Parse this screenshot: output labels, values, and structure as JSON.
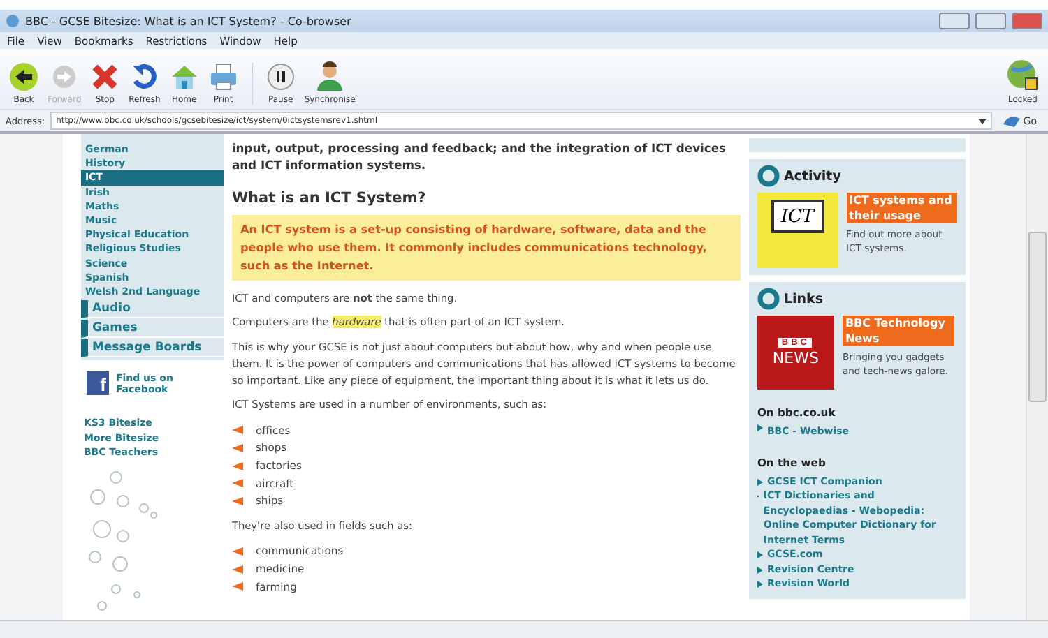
{
  "window": {
    "title": "BBC - GCSE Bitesize: What is an ICT System? - Co-browser"
  },
  "menu": [
    "File",
    "View",
    "Bookmarks",
    "Restrictions",
    "Window",
    "Help"
  ],
  "toolbar": [
    {
      "kind": "back",
      "label": "Back",
      "disabled": false
    },
    {
      "kind": "forward",
      "label": "Forward",
      "disabled": true
    },
    {
      "kind": "stop",
      "label": "Stop",
      "disabled": false
    },
    {
      "kind": "refresh",
      "label": "Refresh",
      "disabled": false
    },
    {
      "kind": "home",
      "label": "Home",
      "disabled": false
    },
    {
      "kind": "print",
      "label": "Print",
      "disabled": false
    },
    {
      "kind": "pause",
      "label": "Pause",
      "disabled": false
    },
    {
      "kind": "sync",
      "label": "Synchronise",
      "disabled": false
    }
  ],
  "lock": {
    "label": "Locked"
  },
  "address": {
    "label": "Address:",
    "value": "http://www.bbc.co.uk/schools/gcsebitesize/ict/system/0ictsystemsrev1.shtml",
    "go": "Go"
  },
  "nav": {
    "subjects": [
      {
        "label": "German",
        "selected": false
      },
      {
        "label": "History",
        "selected": false
      },
      {
        "label": "ICT",
        "selected": true
      },
      {
        "label": "Irish",
        "selected": false
      },
      {
        "label": "Maths",
        "selected": false
      },
      {
        "label": "Music",
        "selected": false
      },
      {
        "label": "Physical Education",
        "selected": false
      },
      {
        "label": "Religious Studies",
        "selected": false
      },
      {
        "label": "Science",
        "selected": false
      },
      {
        "label": "Spanish",
        "selected": false
      },
      {
        "label": "Welsh 2nd Language",
        "selected": false
      }
    ],
    "sections": [
      "Audio",
      "Games",
      "Message Boards"
    ],
    "facebook": "Find us on Facebook",
    "facebook_icon": "f",
    "links": [
      "KS3 Bitesize",
      "More Bitesize",
      "BBC Teachers"
    ]
  },
  "article": {
    "intro": "input, output, processing and feedback; and the integration of ICT devices and ICT information systems.",
    "heading": "What is an ICT System?",
    "definition": "An ICT system is a set-up consisting of hardware, software, data and the people who use them. It commonly includes communications technology, such as the Internet.",
    "paragraphs": [
      "ICT and computers are **not** the same thing.",
      "Computers are the *hardware* that is often part of an ICT system.",
      "This is why your GCSE is not just about computers but about how, why and when people use them. It is the power of computers and communications that has allowed ICT systems to become so important. Like any piece of equipment, the important thing about it is what it lets us do.",
      "ICT Systems are used in a number of environments, such as:"
    ],
    "environments": [
      "offices",
      "shops",
      "factories",
      "aircraft",
      "ships"
    ],
    "fields_intro": "They're also used in fields such as:",
    "fields": [
      "communications",
      "medicine",
      "farming"
    ]
  },
  "activity": {
    "title": "Activity",
    "image_text": "ICT",
    "link": "ICT systems and their usage",
    "description": "Find out more about ICT systems."
  },
  "links": {
    "title": "Links",
    "logo_brand": "BBC",
    "logo_text": "NEWS",
    "link": "BBC Technology News",
    "description": "Bringing you gadgets and tech-news galore.",
    "on_bbc_heading": "On bbc.co.uk",
    "on_bbc": [
      "BBC - Webwise"
    ],
    "on_web_heading": "On the web",
    "on_web": [
      "GCSE ICT Companion",
      "ICT Dictionaries and Encyclopaedias - Webopedia: Online Computer Dictionary for Internet Terms",
      "GCSE.com",
      "Revision Centre",
      "Revision World"
    ]
  }
}
